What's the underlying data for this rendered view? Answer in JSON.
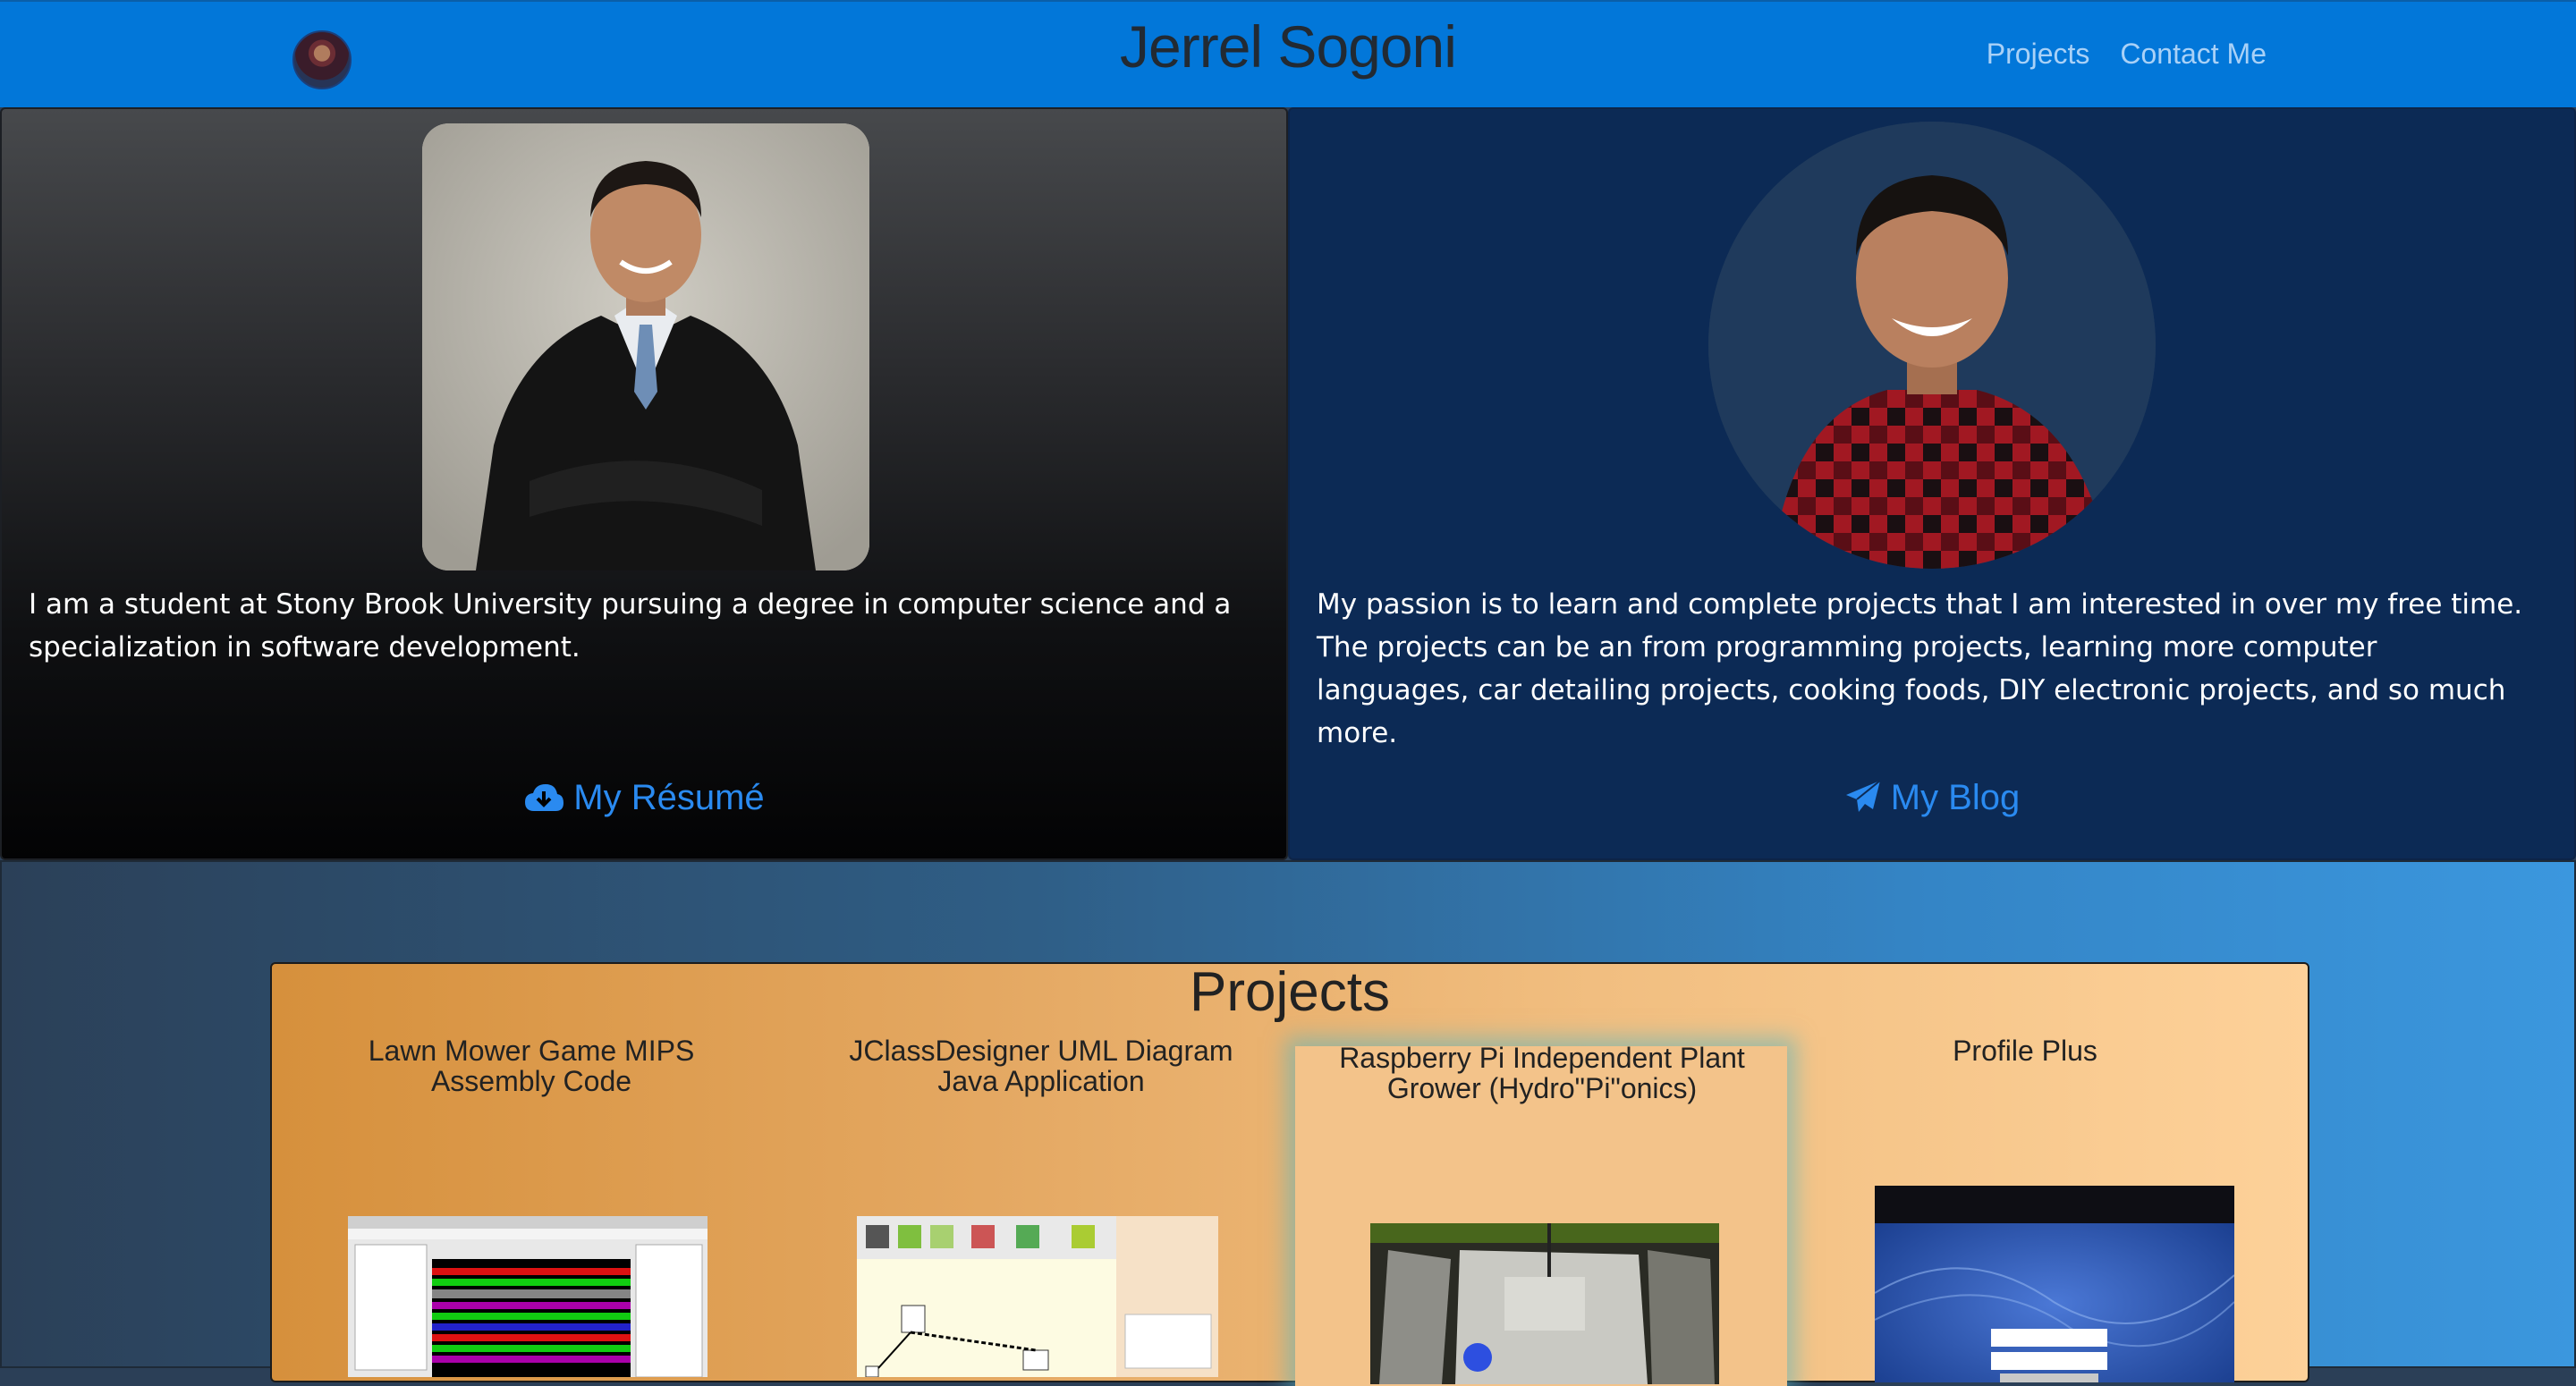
{
  "navbar": {
    "title": "Jerrel Sogoni",
    "links": [
      "Projects",
      "Contact Me"
    ]
  },
  "about": {
    "left_text": "I am a student at Stony Brook University pursuing a degree in computer science and a specialization in software development.",
    "left_button": "My Résumé",
    "left_icon": "cloud-download-icon",
    "right_text": "My passion is to learn and complete projects that I am interested in over my free time. The projects can be an from programming projects, learning more computer languages, car detailing projects, cooking foods, DIY electronic projects, and so much more.",
    "right_button": "My Blog",
    "right_icon": "paper-plane-icon"
  },
  "projects": {
    "title": "Projects",
    "items": [
      {
        "line1": "Lawn Mower Game MIPS",
        "line2": "Assembly Code"
      },
      {
        "line1": "JClassDesigner UML Diagram",
        "line2": "Java Application"
      },
      {
        "line1": "Raspberry Pi Independent Plant",
        "line2": "Grower (Hydro\"Pi\"onics)"
      },
      {
        "line1": "Profile Plus",
        "line2": ""
      }
    ]
  },
  "colors": {
    "navbar": "#0277d9",
    "link": "#2a8af0",
    "nav_link": "#a9d1f7"
  }
}
